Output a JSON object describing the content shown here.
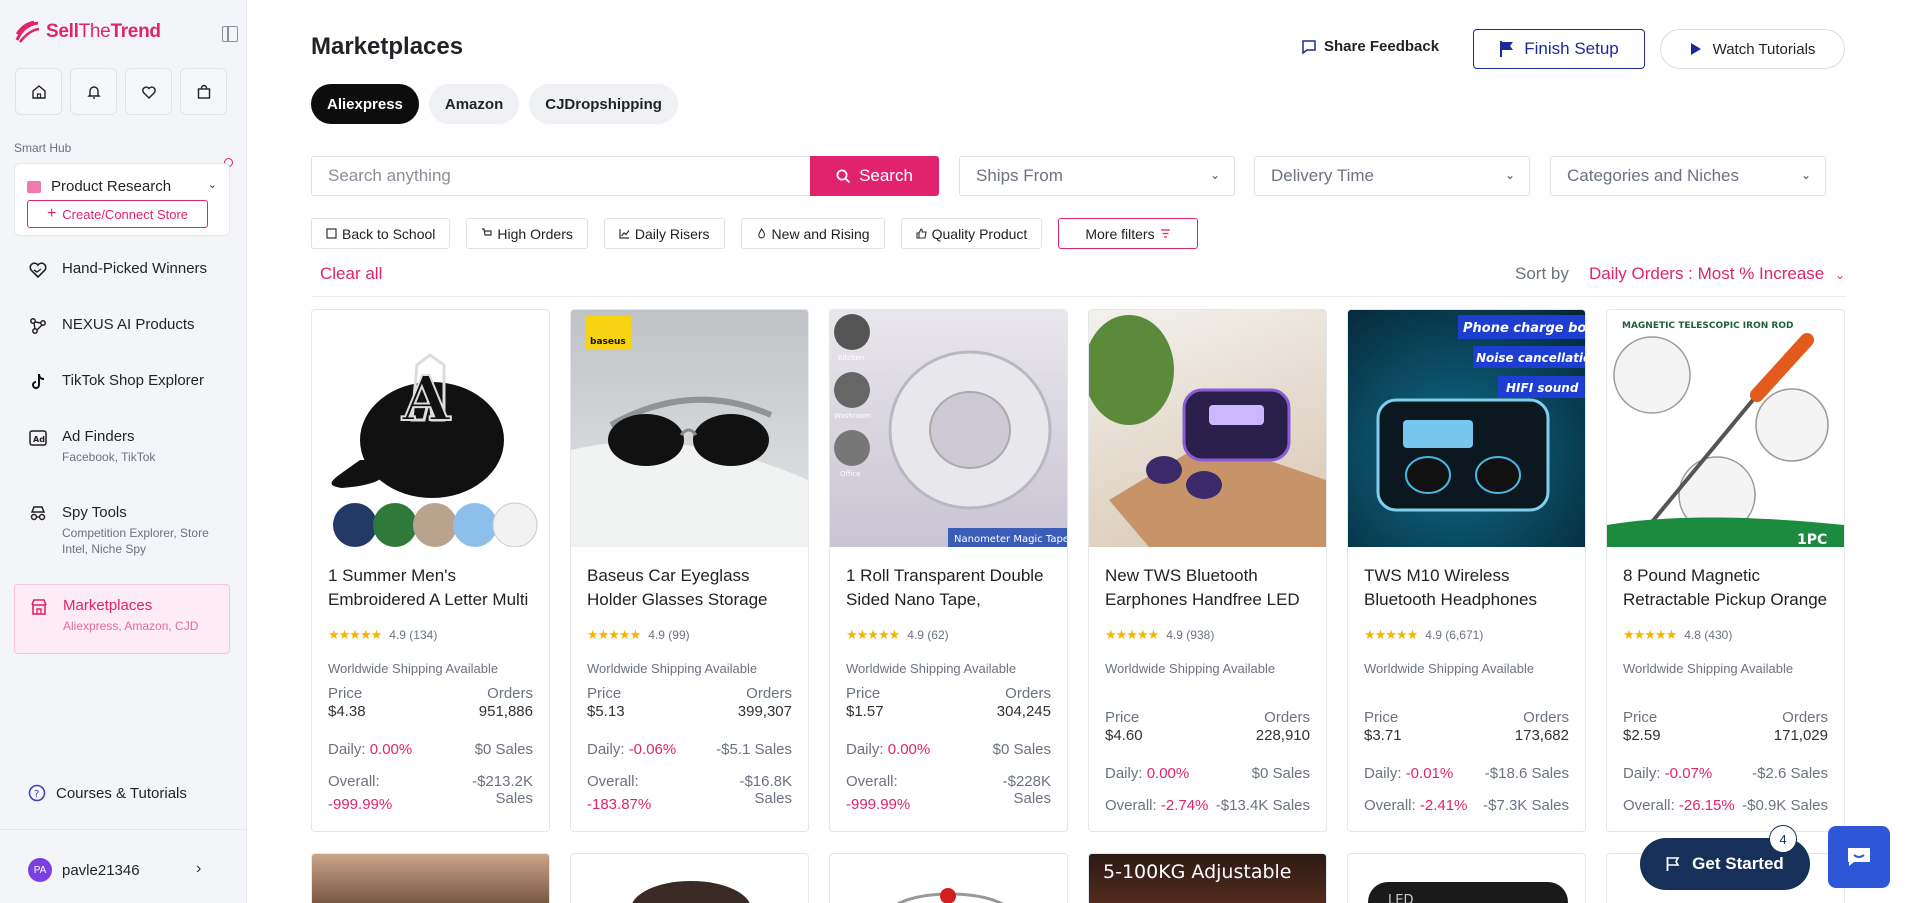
{
  "brand": {
    "name_part1": "Sell",
    "name_part2": "The",
    "name_part3": "Trend"
  },
  "sidebar": {
    "smart_hub_label": "Smart Hub",
    "product_research": "Product Research",
    "create_store": "Create/Connect Store",
    "items": [
      {
        "label": "Hand-Picked Winners",
        "sub": ""
      },
      {
        "label": "NEXUS AI Products",
        "sub": ""
      },
      {
        "label": "TikTok Shop Explorer",
        "sub": ""
      },
      {
        "label": "Ad Finders",
        "sub": "Facebook, TikTok"
      },
      {
        "label": "Spy Tools",
        "sub": "Competition Explorer, Store Intel, Niche Spy"
      },
      {
        "label": "Marketplaces",
        "sub": "Aliexpress, Amazon, CJD"
      }
    ],
    "courses": "Courses & Tutorials",
    "user_initials": "PA",
    "username": "pavle21346"
  },
  "header": {
    "title": "Marketplaces",
    "share_feedback": "Share Feedback",
    "finish_setup": "Finish Setup",
    "watch_tutorials": "Watch Tutorials"
  },
  "tabs": [
    "Aliexpress",
    "Amazon",
    "CJDropshipping"
  ],
  "search": {
    "placeholder": "Search anything",
    "button": "Search"
  },
  "filters": {
    "ships_from": "Ships From",
    "delivery_time": "Delivery Time",
    "categories": "Categories and Niches"
  },
  "chips": [
    "Back to School",
    "High Orders",
    "Daily Risers",
    "New and Rising",
    "Quality Product",
    "More filters"
  ],
  "clear_all": "Clear all",
  "sort": {
    "label": "Sort by",
    "value": "Daily Orders : Most % Increase"
  },
  "labels": {
    "shipping": "Worldwide Shipping Available",
    "price": "Price",
    "orders": "Orders",
    "daily": "Daily:",
    "overall": "Overall:"
  },
  "products": [
    {
      "title": "1 Summer Men's Embroidered A Letter Multi",
      "stars": "★★★★★",
      "rating": "4.9 (134)",
      "price": "$4.38",
      "orders": "951,886",
      "daily_pct": "0.00%",
      "daily_sales": "$0 Sales",
      "overall_sales": "-$213.2K Sales",
      "overall_pct": "-999.99%"
    },
    {
      "title": "Baseus Car Eyeglass Holder Glasses Storage",
      "stars": "★★★★★",
      "rating": "4.9 (99)",
      "price": "$5.13",
      "orders": "399,307",
      "daily_pct": "-0.06%",
      "daily_sales": "-$5.1 Sales",
      "overall_sales": "-$16.8K Sales",
      "overall_pct": "-183.87%"
    },
    {
      "title": "1 Roll Transparent Double Sided Nano Tape,",
      "stars": "★★★★★",
      "rating": "4.9 (62)",
      "price": "$1.57",
      "orders": "304,245",
      "daily_pct": "0.00%",
      "daily_sales": "$0 Sales",
      "overall_sales": "-$228K Sales",
      "overall_pct": "-999.99%"
    },
    {
      "title": "New TWS Bluetooth Earphones Handfree LED",
      "stars": "★★★★★",
      "rating": "4.9 (938)",
      "price": "$4.60",
      "orders": "228,910",
      "daily_pct": "0.00%",
      "daily_sales": "$0 Sales",
      "overall_sales": "-$13.4K Sales",
      "overall_pct": "-2.74%"
    },
    {
      "title": "TWS M10 Wireless Bluetooth Headphones",
      "stars": "★★★★★",
      "rating": "4.9 (6,671)",
      "price": "$3.71",
      "orders": "173,682",
      "daily_pct": "-0.01%",
      "daily_sales": "-$18.6 Sales",
      "overall_sales": "-$7.3K Sales",
      "overall_pct": "-2.41%"
    },
    {
      "title": "8 Pound Magnetic Retractable Pickup Orange",
      "stars": "★★★★★",
      "rating": "4.8 (430)",
      "price": "$2.59",
      "orders": "171,029",
      "daily_pct": "-0.07%",
      "daily_sales": "-$2.6 Sales",
      "overall_sales": "-$0.9K Sales",
      "overall_pct": "-26.15%"
    }
  ],
  "image_text": {
    "baseus": "baseus",
    "tape_kitchen": "Kitchen",
    "tape_washroom": "Washroom",
    "tape_office": "Office",
    "tape_caption": "Nanometer Magic Tape",
    "m10_line1": "Phone charge box",
    "m10_line2": "Noise cancellation",
    "m10_line3": "HIFI sound",
    "rod_caption": "MAGNETIC TELESCOPIC IRON ROD",
    "rod_badge": "1PC",
    "row2_text": "5-100KG Adjustable",
    "row2_led": "LED"
  },
  "get_started": {
    "label": "Get Started",
    "badge": "4"
  }
}
